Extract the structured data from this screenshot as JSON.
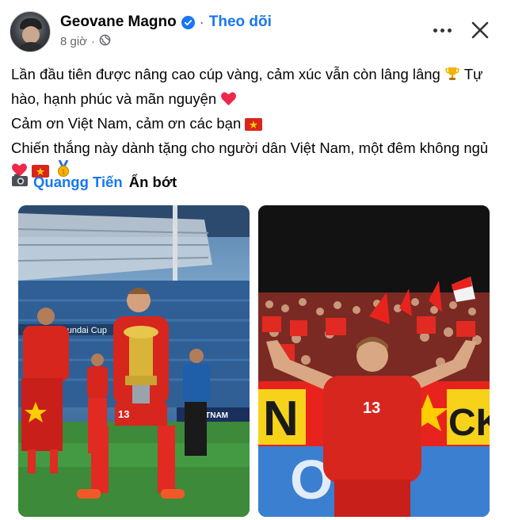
{
  "author": {
    "name": "Geovane Magno",
    "follow_label": "Theo dõi",
    "separator": "·",
    "time": "8 giờ",
    "audience_icon": "globe-icon"
  },
  "actions": {
    "more_icon": "more-horizontal-icon",
    "close_icon": "close-icon"
  },
  "post": {
    "line1": "Lần đầu tiên được nâng cao cúp vàng, cảm xúc vẫn còn lâng lâng",
    "line1_emoji": "🏆",
    "line1_rest": "Tự hào, hạnh phúc và mãn nguyện",
    "line2": "Cảm ơn Việt Nam, cảm ơn các bạn",
    "line3": "Chiến thắng này dành tặng cho người dân Việt Nam, một đêm không ngủ",
    "credit_emoji": "📷",
    "credit_name": "Quangg Tiến",
    "see_less": "Ẩn bớt"
  },
  "photos": {
    "left": {
      "banner_text": "AN Hyundai Cup",
      "sign_text": "VIETNAM",
      "player_number": "13"
    },
    "right": {
      "player_number": "13",
      "banner_text": "N",
      "banner_text2": "CK",
      "lower_text": "OI"
    }
  },
  "colors": {
    "link": "#1877f2",
    "meta": "#65676b",
    "vietnam_red": "#da251d",
    "star_yellow": "#ffcd00"
  }
}
